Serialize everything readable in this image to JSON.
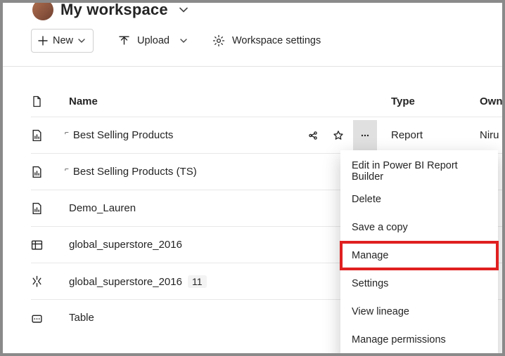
{
  "workspace": {
    "title": "My workspace"
  },
  "toolbar": {
    "new_label": "New",
    "upload_label": "Upload",
    "settings_label": "Workspace settings"
  },
  "table": {
    "headers": {
      "name": "Name",
      "type": "Type",
      "owner": "Owner"
    },
    "rows": [
      {
        "name": "Best Selling Products",
        "type": "Report",
        "owner": "Niru",
        "icon": "paginated-report",
        "marker": true,
        "hover": true
      },
      {
        "name": "Best Selling Products (TS)",
        "type": "",
        "owner": "",
        "icon": "paginated-report",
        "marker": true
      },
      {
        "name": "Demo_Lauren",
        "type": "",
        "owner": "",
        "icon": "report"
      },
      {
        "name": "global_superstore_2016",
        "type": "",
        "owner": "",
        "icon": "dataset"
      },
      {
        "name": "global_superstore_2016",
        "type": "",
        "owner": "",
        "icon": "dataflow",
        "count": "11"
      },
      {
        "name": "Table",
        "type": "",
        "owner": "",
        "icon": "datamart"
      }
    ]
  },
  "context_menu": {
    "items": [
      "Edit in Power BI Report Builder",
      "Delete",
      "Save a copy",
      "Manage",
      "Settings",
      "View lineage",
      "Manage permissions"
    ],
    "highlight_index": 3
  }
}
